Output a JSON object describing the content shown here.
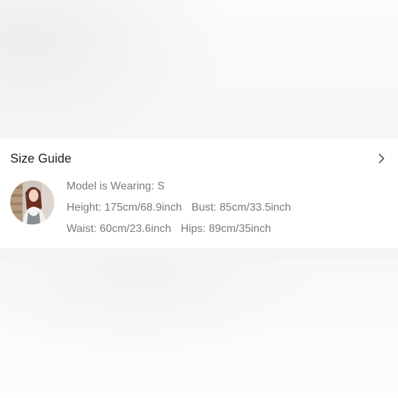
{
  "size_guide": {
    "title": "Size Guide",
    "chevron_icon": "chevron-right-icon",
    "model_wearing": "Model is Wearing: S",
    "height": "Height: 175cm/68.9inch",
    "bust": "Bust: 85cm/33.5inch",
    "waist": "Waist: 60cm/23.6inch",
    "hips": "Hips: 89cm/35inch"
  }
}
